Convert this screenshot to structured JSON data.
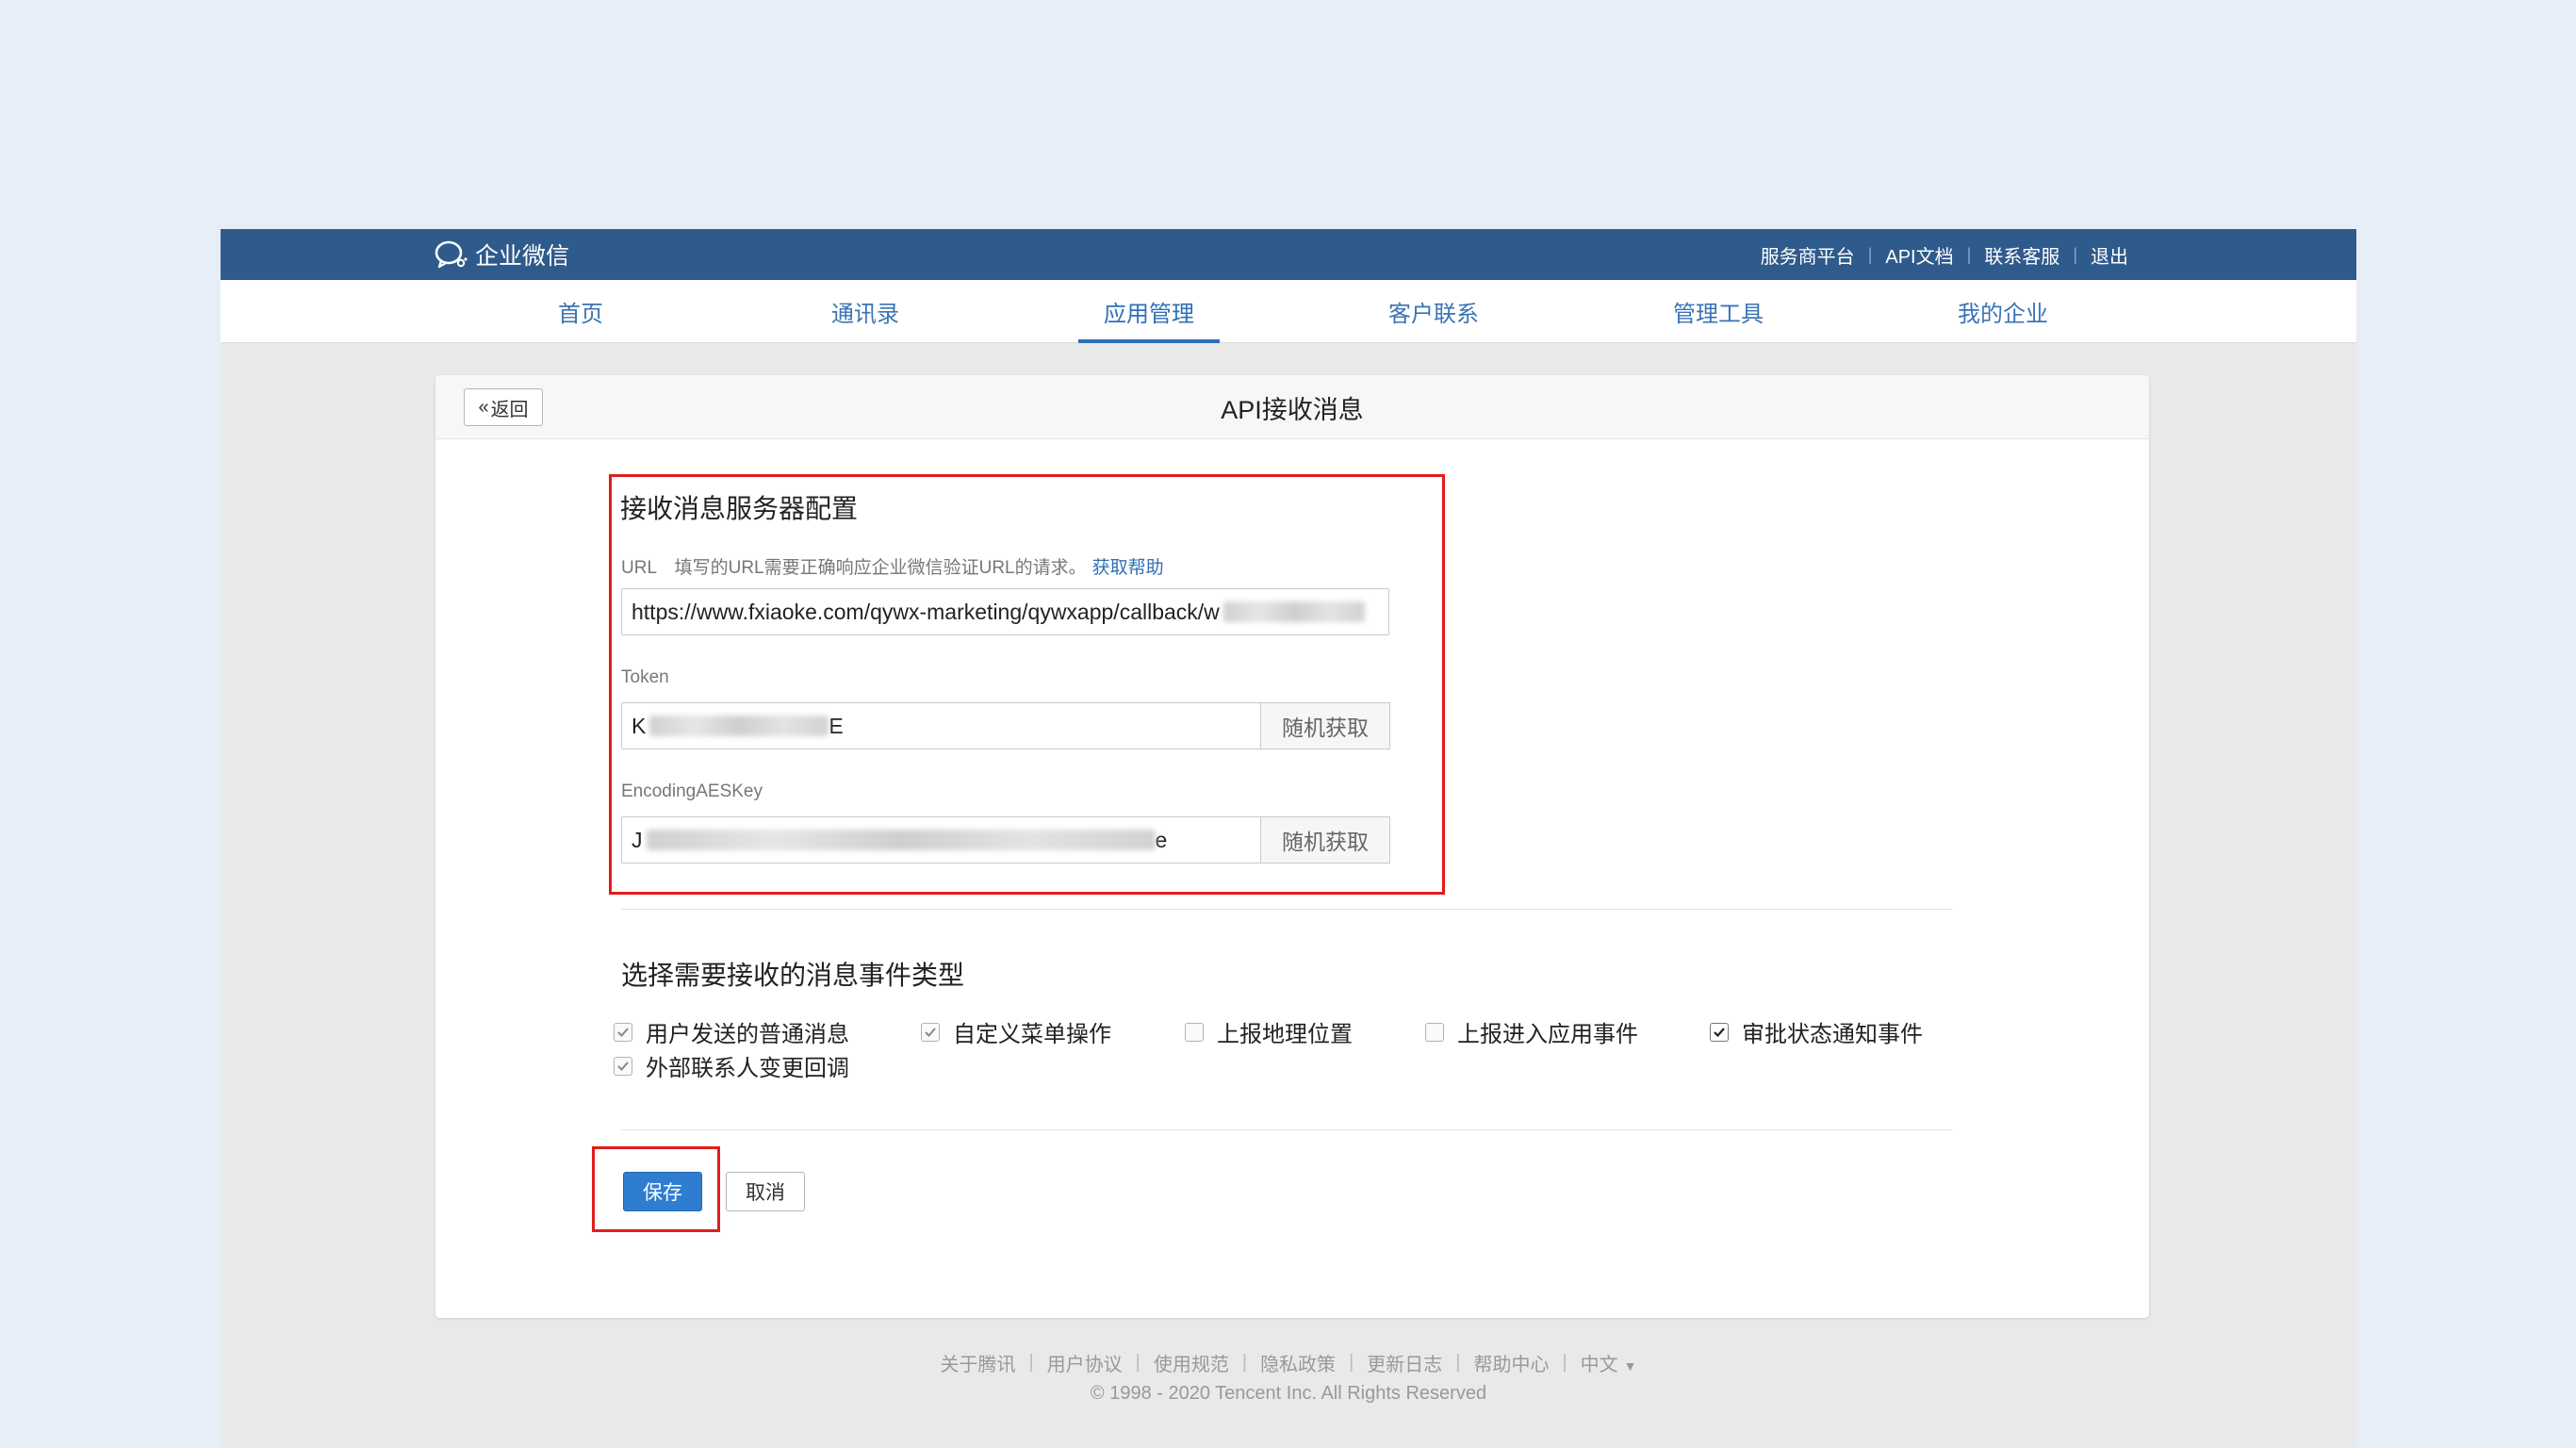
{
  "topbar": {
    "brand": "企业微信",
    "links": [
      "服务商平台",
      "API文档",
      "联系客服",
      "退出"
    ]
  },
  "nav": {
    "items": [
      "首页",
      "通讯录",
      "应用管理",
      "客户联系",
      "管理工具",
      "我的企业"
    ],
    "active": "应用管理"
  },
  "card": {
    "back_label": "返回",
    "title": "API接收消息"
  },
  "server_config": {
    "title": "接收消息服务器配置",
    "url_label": "URL",
    "url_hint": "填写的URL需要正确响应企业微信验证URL的请求。",
    "url_help": "获取帮助",
    "url_value": "https://www.fxiaoke.com/qywx-marketing/qywxapp/callback/w",
    "token_label": "Token",
    "token_value_start": "K",
    "token_value_end": "E",
    "aes_label": "EncodingAESKey",
    "aes_value_start": "J",
    "aes_value_end": "e",
    "random_label": "随机获取"
  },
  "events": {
    "title": "选择需要接收的消息事件类型",
    "items": [
      {
        "label": "用户发送的普通消息",
        "checked": true,
        "disabled": true
      },
      {
        "label": "自定义菜单操作",
        "checked": true,
        "disabled": true
      },
      {
        "label": "上报地理位置",
        "checked": false,
        "disabled": false
      },
      {
        "label": "上报进入应用事件",
        "checked": false,
        "disabled": false
      },
      {
        "label": "审批状态通知事件",
        "checked": true,
        "disabled": false
      },
      {
        "label": "外部联系人变更回调",
        "checked": true,
        "disabled": true
      }
    ]
  },
  "actions": {
    "save": "保存",
    "cancel": "取消"
  },
  "footer": {
    "links": [
      "关于腾讯",
      "用户协议",
      "使用规范",
      "隐私政策",
      "更新日志",
      "帮助中心",
      "中文"
    ],
    "copyright": "© 1998 - 2020 Tencent Inc. All Rights Reserved"
  },
  "colors": {
    "topbar": "#2f5a8c",
    "accent": "#2f6fb8",
    "highlight": "#e31c1c"
  }
}
